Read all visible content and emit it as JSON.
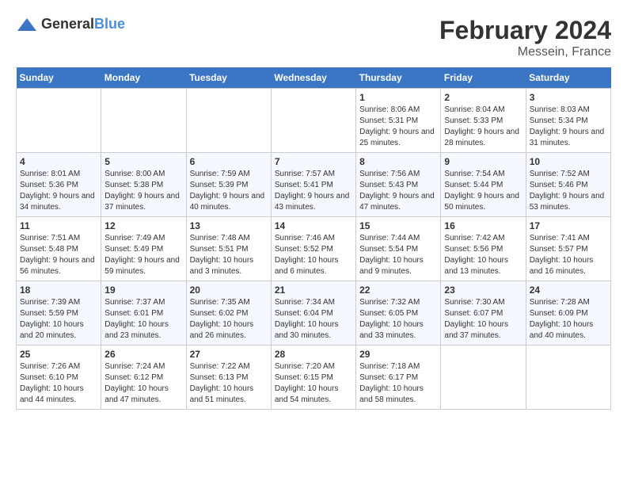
{
  "logo": {
    "text_general": "General",
    "text_blue": "Blue"
  },
  "title": "February 2024",
  "subtitle": "Messein, France",
  "days_header": [
    "Sunday",
    "Monday",
    "Tuesday",
    "Wednesday",
    "Thursday",
    "Friday",
    "Saturday"
  ],
  "weeks": [
    [
      {
        "day": "",
        "info": ""
      },
      {
        "day": "",
        "info": ""
      },
      {
        "day": "",
        "info": ""
      },
      {
        "day": "",
        "info": ""
      },
      {
        "day": "1",
        "info": "Sunrise: 8:06 AM\nSunset: 5:31 PM\nDaylight: 9 hours and 25 minutes."
      },
      {
        "day": "2",
        "info": "Sunrise: 8:04 AM\nSunset: 5:33 PM\nDaylight: 9 hours and 28 minutes."
      },
      {
        "day": "3",
        "info": "Sunrise: 8:03 AM\nSunset: 5:34 PM\nDaylight: 9 hours and 31 minutes."
      }
    ],
    [
      {
        "day": "4",
        "info": "Sunrise: 8:01 AM\nSunset: 5:36 PM\nDaylight: 9 hours and 34 minutes."
      },
      {
        "day": "5",
        "info": "Sunrise: 8:00 AM\nSunset: 5:38 PM\nDaylight: 9 hours and 37 minutes."
      },
      {
        "day": "6",
        "info": "Sunrise: 7:59 AM\nSunset: 5:39 PM\nDaylight: 9 hours and 40 minutes."
      },
      {
        "day": "7",
        "info": "Sunrise: 7:57 AM\nSunset: 5:41 PM\nDaylight: 9 hours and 43 minutes."
      },
      {
        "day": "8",
        "info": "Sunrise: 7:56 AM\nSunset: 5:43 PM\nDaylight: 9 hours and 47 minutes."
      },
      {
        "day": "9",
        "info": "Sunrise: 7:54 AM\nSunset: 5:44 PM\nDaylight: 9 hours and 50 minutes."
      },
      {
        "day": "10",
        "info": "Sunrise: 7:52 AM\nSunset: 5:46 PM\nDaylight: 9 hours and 53 minutes."
      }
    ],
    [
      {
        "day": "11",
        "info": "Sunrise: 7:51 AM\nSunset: 5:48 PM\nDaylight: 9 hours and 56 minutes."
      },
      {
        "day": "12",
        "info": "Sunrise: 7:49 AM\nSunset: 5:49 PM\nDaylight: 9 hours and 59 minutes."
      },
      {
        "day": "13",
        "info": "Sunrise: 7:48 AM\nSunset: 5:51 PM\nDaylight: 10 hours and 3 minutes."
      },
      {
        "day": "14",
        "info": "Sunrise: 7:46 AM\nSunset: 5:52 PM\nDaylight: 10 hours and 6 minutes."
      },
      {
        "day": "15",
        "info": "Sunrise: 7:44 AM\nSunset: 5:54 PM\nDaylight: 10 hours and 9 minutes."
      },
      {
        "day": "16",
        "info": "Sunrise: 7:42 AM\nSunset: 5:56 PM\nDaylight: 10 hours and 13 minutes."
      },
      {
        "day": "17",
        "info": "Sunrise: 7:41 AM\nSunset: 5:57 PM\nDaylight: 10 hours and 16 minutes."
      }
    ],
    [
      {
        "day": "18",
        "info": "Sunrise: 7:39 AM\nSunset: 5:59 PM\nDaylight: 10 hours and 20 minutes."
      },
      {
        "day": "19",
        "info": "Sunrise: 7:37 AM\nSunset: 6:01 PM\nDaylight: 10 hours and 23 minutes."
      },
      {
        "day": "20",
        "info": "Sunrise: 7:35 AM\nSunset: 6:02 PM\nDaylight: 10 hours and 26 minutes."
      },
      {
        "day": "21",
        "info": "Sunrise: 7:34 AM\nSunset: 6:04 PM\nDaylight: 10 hours and 30 minutes."
      },
      {
        "day": "22",
        "info": "Sunrise: 7:32 AM\nSunset: 6:05 PM\nDaylight: 10 hours and 33 minutes."
      },
      {
        "day": "23",
        "info": "Sunrise: 7:30 AM\nSunset: 6:07 PM\nDaylight: 10 hours and 37 minutes."
      },
      {
        "day": "24",
        "info": "Sunrise: 7:28 AM\nSunset: 6:09 PM\nDaylight: 10 hours and 40 minutes."
      }
    ],
    [
      {
        "day": "25",
        "info": "Sunrise: 7:26 AM\nSunset: 6:10 PM\nDaylight: 10 hours and 44 minutes."
      },
      {
        "day": "26",
        "info": "Sunrise: 7:24 AM\nSunset: 6:12 PM\nDaylight: 10 hours and 47 minutes."
      },
      {
        "day": "27",
        "info": "Sunrise: 7:22 AM\nSunset: 6:13 PM\nDaylight: 10 hours and 51 minutes."
      },
      {
        "day": "28",
        "info": "Sunrise: 7:20 AM\nSunset: 6:15 PM\nDaylight: 10 hours and 54 minutes."
      },
      {
        "day": "29",
        "info": "Sunrise: 7:18 AM\nSunset: 6:17 PM\nDaylight: 10 hours and 58 minutes."
      },
      {
        "day": "",
        "info": ""
      },
      {
        "day": "",
        "info": ""
      }
    ]
  ]
}
